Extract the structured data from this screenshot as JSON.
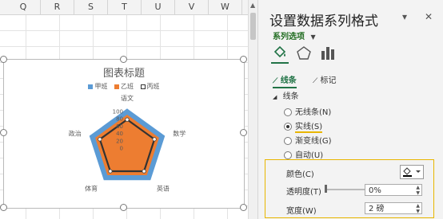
{
  "sheet": {
    "columns": [
      "Q",
      "R",
      "S",
      "T",
      "U",
      "V",
      "W"
    ]
  },
  "chart": {
    "title": "图表标题",
    "legend": [
      {
        "label": "甲班",
        "color": "#5b9bd5"
      },
      {
        "label": "乙班",
        "color": "#ed7d31"
      },
      {
        "label": "丙班",
        "color": "#333333"
      }
    ]
  },
  "chart_data": {
    "type": "radar",
    "title": "图表标题",
    "categories": [
      "语文",
      "数学",
      "英语",
      "体育",
      "政治"
    ],
    "axis_ticks": [
      "100",
      "80",
      "60",
      "40",
      "20",
      "0"
    ],
    "rlim": [
      0,
      100
    ],
    "series": [
      {
        "name": "甲班",
        "values": [
          100,
          100,
          100,
          100,
          100
        ],
        "color": "#5b9bd5"
      },
      {
        "name": "乙班",
        "values": [
          90,
          90,
          90,
          90,
          90
        ],
        "color": "#ed7d31"
      },
      {
        "name": "丙班",
        "values": [
          78,
          78,
          78,
          78,
          78
        ],
        "color": "#333333"
      }
    ],
    "legend_position": "top",
    "grid": true
  },
  "panel": {
    "title": "设置数据系列格式",
    "subheader": "系列选项",
    "icons": [
      "fill-line-icon",
      "effects-icon",
      "series-options-icon"
    ],
    "tabs": [
      "线条",
      "标记"
    ],
    "section": "线条",
    "line_options": [
      {
        "label": "无线条(N)",
        "selected": false
      },
      {
        "label": "实线(S)",
        "selected": true
      },
      {
        "label": "渐变线(G)",
        "selected": false
      },
      {
        "label": "自动(U)",
        "selected": false
      }
    ],
    "color_label": "颜色(C)",
    "transparency_label": "透明度(T)",
    "transparency_value": "0%",
    "width_label": "宽度(W)",
    "width_value": "2 磅"
  }
}
